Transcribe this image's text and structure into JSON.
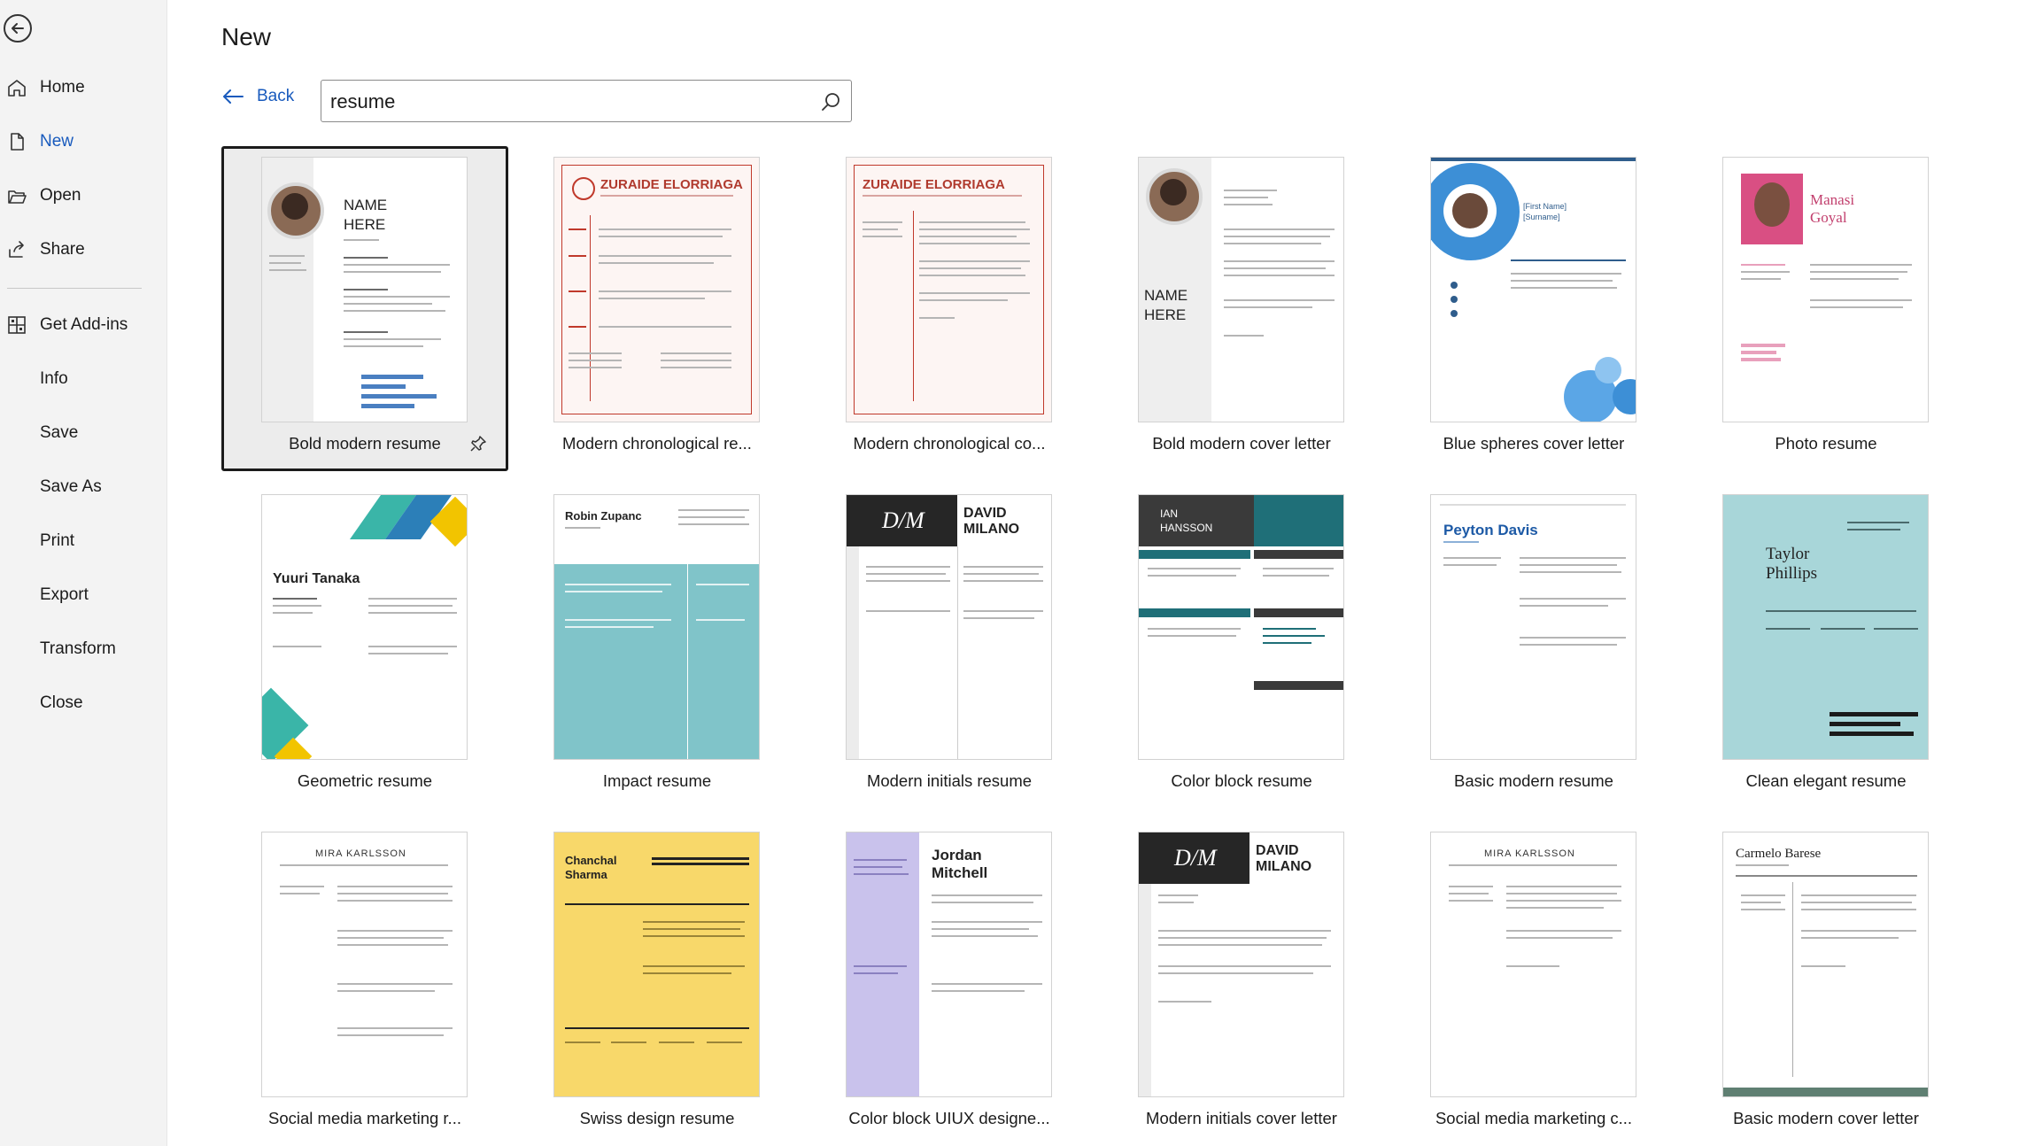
{
  "sidebar": {
    "back_label": "Back",
    "items": [
      {
        "label": "Home",
        "icon": "home-icon"
      },
      {
        "label": "New",
        "icon": "new-document-icon"
      },
      {
        "label": "Open",
        "icon": "folder-open-icon"
      },
      {
        "label": "Share",
        "icon": "share-icon"
      },
      {
        "label": "Get Add-ins",
        "icon": "grid-icon"
      },
      {
        "label": "Info"
      },
      {
        "label": "Save"
      },
      {
        "label": "Save As"
      },
      {
        "label": "Print"
      },
      {
        "label": "Export"
      },
      {
        "label": "Transform"
      },
      {
        "label": "Close"
      }
    ],
    "active": "New"
  },
  "main": {
    "title": "New",
    "back_label": "Back",
    "search": {
      "value": "resume",
      "placeholder": ""
    },
    "templates": [
      {
        "label": "Bold modern resume",
        "selected": true
      },
      {
        "label": "Modern chronological re..."
      },
      {
        "label": "Modern chronological co..."
      },
      {
        "label": "Bold modern cover letter"
      },
      {
        "label": "Blue spheres cover letter"
      },
      {
        "label": "Photo resume"
      },
      {
        "label": "Geometric resume"
      },
      {
        "label": "Impact resume"
      },
      {
        "label": "Modern initials resume"
      },
      {
        "label": "Color block resume"
      },
      {
        "label": "Basic modern resume"
      },
      {
        "label": "Clean elegant resume"
      },
      {
        "label": "Social media marketing r..."
      },
      {
        "label": "Swiss design resume"
      },
      {
        "label": "Color block UIUX designe..."
      },
      {
        "label": "Modern initials cover letter"
      },
      {
        "label": "Social media marketing c..."
      },
      {
        "label": "Basic modern cover letter"
      }
    ],
    "thumb_text": {
      "name_here": "NAME",
      "name_here2": "HERE",
      "zuraide": "ZURAIDE ELORRIAGA",
      "first_name": "[First Name]",
      "surname": "[Surname]",
      "manasi": "Manasi",
      "goyal": "Goyal",
      "yuuri": "Yuuri Tanaka",
      "robin": "Robin Zupanc",
      "dm": "D/M",
      "david": "DAVID",
      "milano": "MILANO",
      "ian": "IAN",
      "hanson": "HANSSON",
      "peyton": "Peyton Davis",
      "taylor": "Taylor",
      "phillips": "Phillips",
      "mira": "MIRA KARLSSON",
      "chanchal": "Chanchal",
      "sharma": "Sharma",
      "jordan": "Jordan",
      "mitchell": "Mitchell",
      "carmelo": "Carmelo Barese"
    }
  },
  "colors": {
    "accent": "#185abd",
    "sidebar_bg": "#f3f3f3",
    "selected_bg": "#ececec"
  }
}
